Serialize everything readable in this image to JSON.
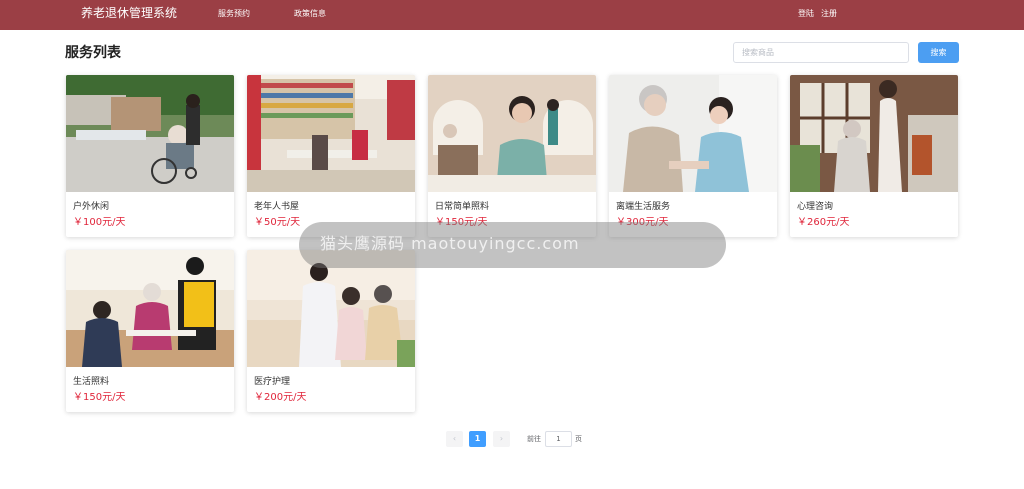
{
  "header": {
    "brand": "养老退休管理系统",
    "nav": [
      "服务预约",
      "政策信息"
    ],
    "login": "登陆",
    "register": "注册",
    "bg_color": "#9b3f45"
  },
  "main": {
    "title": "服务列表",
    "search": {
      "placeholder": "搜索商品",
      "button": "搜索"
    }
  },
  "services": [
    {
      "name": "户外休闲",
      "price": "￥100元/天",
      "icon": "photo-outdoor-wheelchair"
    },
    {
      "name": "老年人书屋",
      "price": "￥50元/天",
      "icon": "photo-library"
    },
    {
      "name": "日常简单照料",
      "price": "￥150元/天",
      "icon": "photo-daily-care"
    },
    {
      "name": "离端生活服务",
      "price": "￥300元/天",
      "icon": "photo-caregiver"
    },
    {
      "name": "心理咨询",
      "price": "￥260元/天",
      "icon": "photo-counseling"
    },
    {
      "name": "生活照料",
      "price": "￥150元/天",
      "icon": "photo-meal-service"
    },
    {
      "name": "医疗护理",
      "price": "￥200元/天",
      "icon": "photo-medical-care"
    }
  ],
  "pagination": {
    "prev": "‹",
    "current": "1",
    "next": "›",
    "goto_label": "前往",
    "goto_value": "1",
    "unit": "页"
  },
  "watermark": "猫头鹰源码 maotouyingcc.com",
  "colors": {
    "accent": "#409eff",
    "price": "#e0263b"
  }
}
